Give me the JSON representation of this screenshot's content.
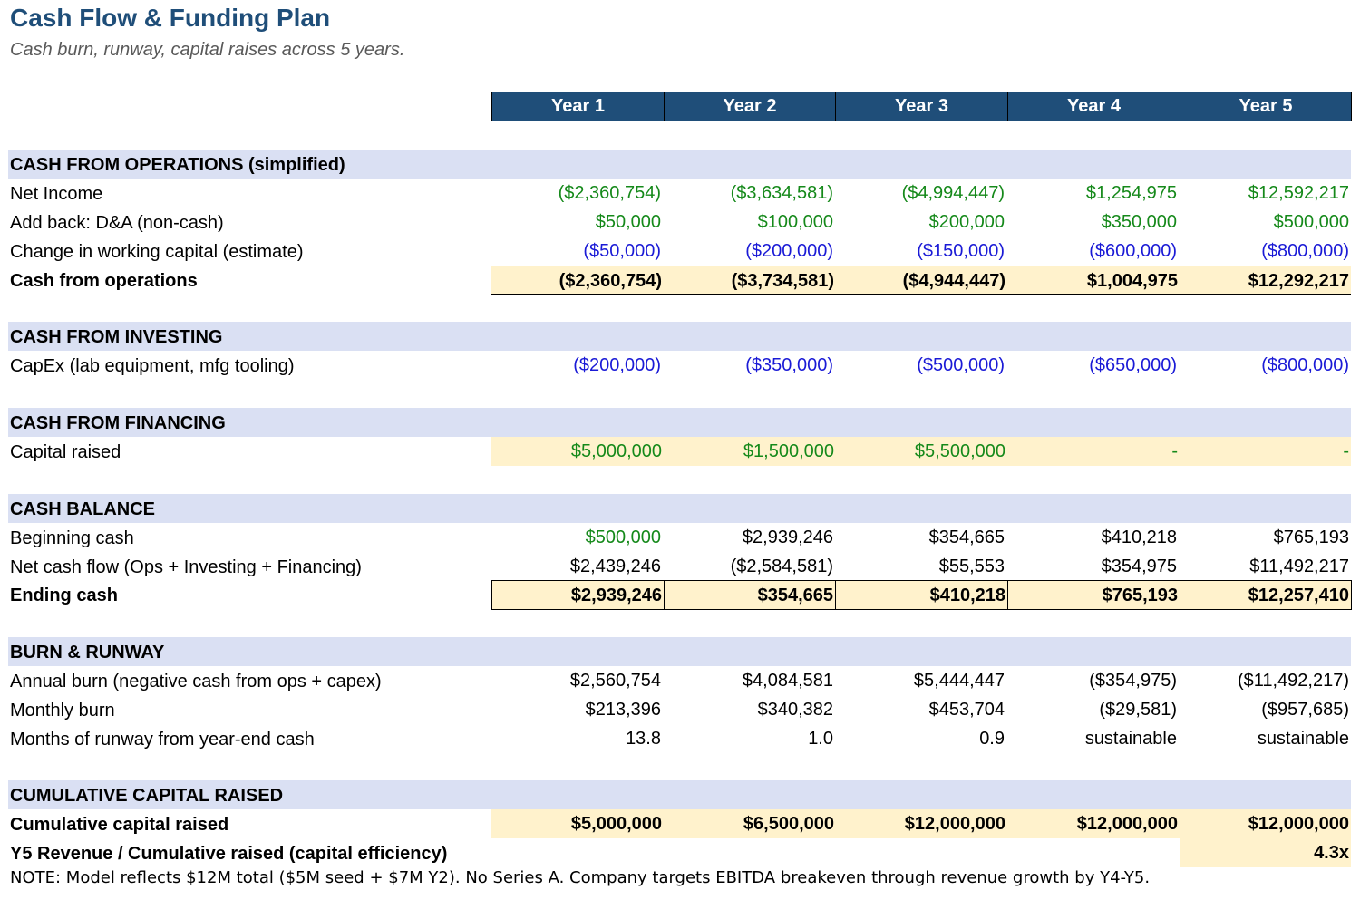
{
  "title": "Cash Flow & Funding Plan",
  "subtitle": "Cash burn, runway, capital raises across 5 years.",
  "years": [
    "Year 1",
    "Year 2",
    "Year 3",
    "Year 4",
    "Year 5"
  ],
  "operations": {
    "header": "CASH FROM OPERATIONS (simplified)",
    "net_income": {
      "label": "Net Income",
      "values": [
        "($2,360,754)",
        "($3,634,581)",
        "($4,994,447)",
        "$1,254,975",
        "$12,592,217"
      ]
    },
    "da": {
      "label": "Add back: D&A (non-cash)",
      "values": [
        "$50,000",
        "$100,000",
        "$200,000",
        "$350,000",
        "$500,000"
      ]
    },
    "wc": {
      "label": "Change in working capital (estimate)",
      "values": [
        "($50,000)",
        "($200,000)",
        "($150,000)",
        "($600,000)",
        "($800,000)"
      ]
    },
    "total": {
      "label": "Cash from operations",
      "values": [
        "($2,360,754)",
        "($3,734,581)",
        "($4,944,447)",
        "$1,004,975",
        "$12,292,217"
      ]
    }
  },
  "investing": {
    "header": "CASH FROM INVESTING",
    "capex": {
      "label": "CapEx (lab equipment, mfg tooling)",
      "values": [
        "($200,000)",
        "($350,000)",
        "($500,000)",
        "($650,000)",
        "($800,000)"
      ]
    }
  },
  "financing": {
    "header": "CASH FROM FINANCING",
    "capital": {
      "label": "Capital raised",
      "values": [
        "$5,000,000",
        "$1,500,000",
        "$5,500,000",
        "-",
        "-"
      ]
    }
  },
  "balance": {
    "header": "CASH BALANCE",
    "beginning": {
      "label": "Beginning cash",
      "values": [
        "$500,000",
        "$2,939,246",
        "$354,665",
        "$410,218",
        "$765,193"
      ]
    },
    "net_flow": {
      "label": "Net cash flow (Ops + Investing + Financing)",
      "values": [
        "$2,439,246",
        "($2,584,581)",
        "$55,553",
        "$354,975",
        "$11,492,217"
      ]
    },
    "ending": {
      "label": "Ending cash",
      "values": [
        "$2,939,246",
        "$354,665",
        "$410,218",
        "$765,193",
        "$12,257,410"
      ]
    }
  },
  "burn": {
    "header": "BURN & RUNWAY",
    "annual": {
      "label": "Annual burn (negative cash from ops + capex)",
      "values": [
        "$2,560,754",
        "$4,084,581",
        "$5,444,447",
        "($354,975)",
        "($11,492,217)"
      ]
    },
    "monthly": {
      "label": "Monthly burn",
      "values": [
        "$213,396",
        "$340,382",
        "$453,704",
        "($29,581)",
        "($957,685)"
      ]
    },
    "runway": {
      "label": "Months of runway from year-end cash",
      "values": [
        "13.8",
        "1.0",
        "0.9",
        "sustainable",
        "sustainable"
      ]
    }
  },
  "cumulative": {
    "header": "CUMULATIVE CAPITAL RAISED",
    "raised": {
      "label": "Cumulative capital raised",
      "values": [
        "$5,000,000",
        "$6,500,000",
        "$12,000,000",
        "$12,000,000",
        "$12,000,000"
      ]
    },
    "efficiency": {
      "label": "Y5 Revenue / Cumulative raised (capital efficiency)",
      "value": "4.3x"
    }
  },
  "note": "NOTE: Model reflects $12M total ($5M seed + $7M Y2). No Series A. Company targets EBITDA breakeven through revenue growth by Y4-Y5.",
  "colors": {
    "header_bg": "#1f4e79",
    "section_bg": "#dae0f3",
    "highlight": "#fff2cc",
    "input_green": "#15891a",
    "input_blue": "#1a1ad6"
  }
}
